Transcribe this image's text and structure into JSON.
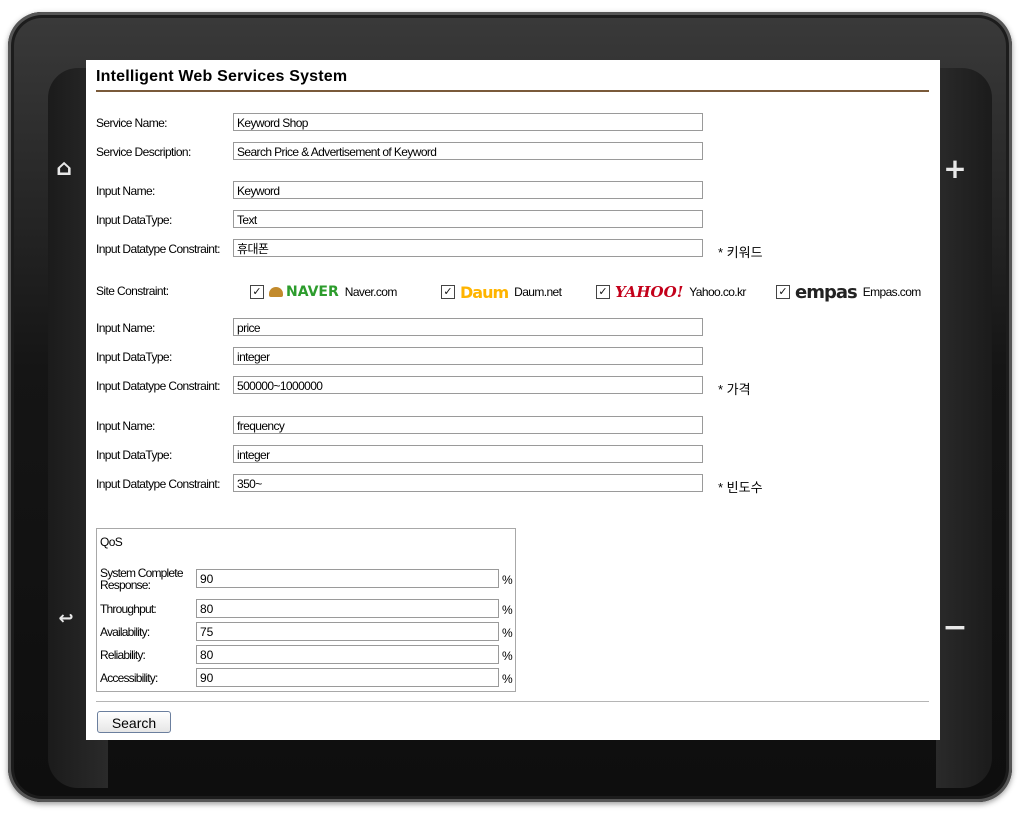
{
  "app": {
    "title": "Intelligent Web Services System"
  },
  "service": {
    "name_label": "Service Name:",
    "name_value": "Keyword Shop",
    "desc_label": "Service Description:",
    "desc_value": "Search Price & Advertisement of Keyword"
  },
  "inputs": [
    {
      "name_label": "Input Name:",
      "name_value": "Keyword",
      "type_label": "Input DataType:",
      "type_value": "Text",
      "constraint_label": "Input Datatype Constraint:",
      "constraint_value": "휴대폰",
      "note": "* 키워드"
    },
    {
      "name_label": "Input Name:",
      "name_value": "price",
      "type_label": "Input DataType:",
      "type_value": "integer",
      "constraint_label": "Input Datatype Constraint:",
      "constraint_value": "500000~1000000",
      "note": "* 가격"
    },
    {
      "name_label": "Input Name:",
      "name_value": "frequency",
      "type_label": "Input DataType:",
      "type_value": "integer",
      "constraint_label": "Input Datatype Constraint:",
      "constraint_value": "350~",
      "note": "* 빈도수"
    }
  ],
  "site_constraint": {
    "label": "Site Constraint:",
    "sites": [
      {
        "logo": "NAVER",
        "name": "Naver.com",
        "checked": true,
        "logo_icon": "naver-logo-icon"
      },
      {
        "logo": "Daum",
        "name": "Daum.net",
        "checked": true,
        "logo_icon": "daum-logo-icon"
      },
      {
        "logo": "YAHOO!",
        "name": "Yahoo.co.kr",
        "checked": true,
        "logo_icon": "yahoo-logo-icon"
      },
      {
        "logo": "empas",
        "name": "Empas.com",
        "checked": true,
        "logo_icon": "empas-logo-icon"
      }
    ],
    "check_glyph": "✓"
  },
  "qos": {
    "title": "QoS",
    "unit": "%",
    "items": [
      {
        "label": "System Complete Response:",
        "value": "90"
      },
      {
        "label": "Throughput:",
        "value": "80"
      },
      {
        "label": "Availability:",
        "value": "75"
      },
      {
        "label": "Reliability:",
        "value": "80"
      },
      {
        "label": "Accessibility:",
        "value": "90"
      }
    ]
  },
  "actions": {
    "search_label": "Search"
  },
  "device": {
    "home_icon": "home-icon",
    "back_icon": "back-icon",
    "plus_label": "+",
    "minus_label": "−",
    "home_glyph": "⌂",
    "back_glyph": "↩"
  },
  "colors": {
    "title_rule": "#7a5a3a",
    "naver": "#2c9c2c",
    "yahoo": "#c3001a"
  }
}
